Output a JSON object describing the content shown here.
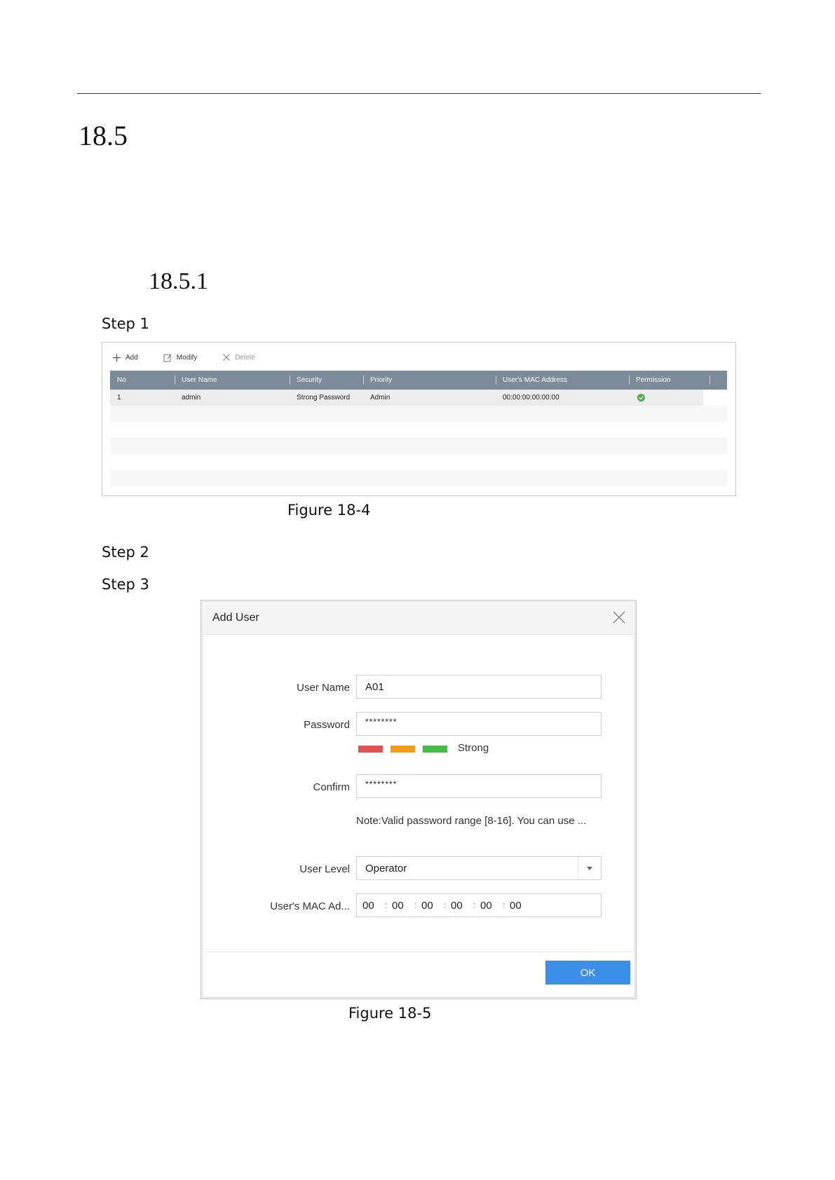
{
  "section": {
    "number": "18.5"
  },
  "subsection": {
    "number": "18.5.1"
  },
  "steps": {
    "s1": "Step 1",
    "s2": "Step 2",
    "s3": "Step 3"
  },
  "figure4": {
    "caption": "Figure 18-4",
    "toolbar": {
      "add": "Add",
      "modify": "Modify",
      "delete": "Delete"
    },
    "columns": [
      "No",
      "User Name",
      "Security",
      "Priority",
      "User's MAC Address",
      "Permission"
    ],
    "rows": [
      {
        "no": "1",
        "user_name": "admin",
        "security": "Strong Password",
        "priority": "Admin",
        "mac": "00:00:00:00:00:00",
        "permission": "check-icon"
      }
    ],
    "header_color": "#7d8a99"
  },
  "figure5": {
    "caption": "Figure 18-5",
    "title": "Add User",
    "labels": {
      "user_name": "User Name",
      "password": "Password",
      "confirm": "Confirm",
      "user_level": "User Level",
      "mac": "User's MAC Ad..."
    },
    "values": {
      "user_name": "A01",
      "password": "********",
      "confirm": "********",
      "user_level": "Operator",
      "mac": [
        "00",
        "00",
        "00",
        "00",
        "00",
        "00"
      ]
    },
    "strength": {
      "label": "Strong",
      "colors": [
        "#e05252",
        "#f39c12",
        "#44bb44"
      ]
    },
    "note": "Note:Valid password range [8-16]. You can use ...",
    "ok": "OK",
    "accent": "#3d8ee8"
  }
}
